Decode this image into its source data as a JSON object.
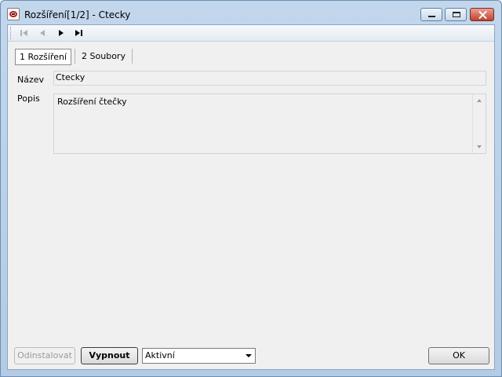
{
  "window": {
    "title": "Rozšíření[1/2] - Ctecky"
  },
  "tabs": [
    {
      "label": "1 Rozšíření",
      "active": true
    },
    {
      "label": "2 Soubory",
      "active": false
    }
  ],
  "form": {
    "name_label": "Název",
    "name_value": "Ctecky",
    "desc_label": "Popis",
    "desc_value": "Rozšíření čtečky"
  },
  "footer": {
    "uninstall_label": "Odinstalovat",
    "disable_label": "Vypnout",
    "status_value": "Aktivní",
    "ok_label": "OK"
  },
  "colors": {
    "titlebar": "#c2d7ec",
    "close_button": "#c0422e"
  }
}
